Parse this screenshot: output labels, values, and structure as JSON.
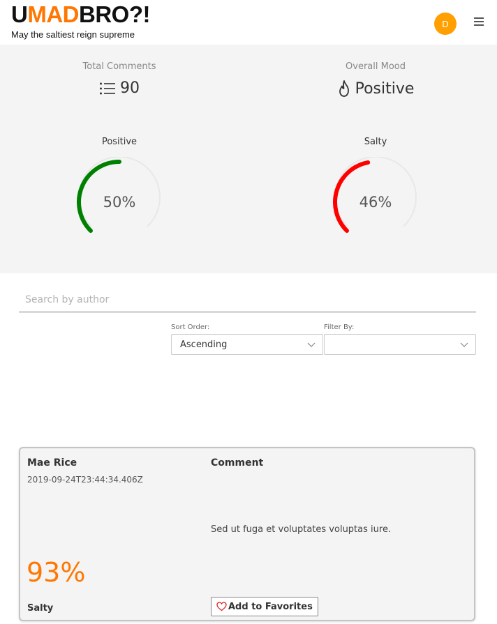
{
  "header": {
    "logo_u": "U",
    "logo_mad": "MAD",
    "logo_rest": "BRO?!",
    "tagline": "May the saltiest reign supreme",
    "avatar_initial": "D",
    "menu_icon": "hamburger-menu-icon"
  },
  "stats": {
    "total_comments_label": "Total Comments",
    "total_comments_value": "90",
    "total_comments_icon": "list-icon",
    "overall_mood_label": "Overall Mood",
    "overall_mood_value": "Positive",
    "overall_mood_icon": "flame-icon",
    "positive_gauge": {
      "label": "Positive",
      "text": "50%",
      "percent": 50,
      "color": "#008000"
    },
    "salty_gauge": {
      "label": "Salty",
      "text": "46%",
      "percent": 46,
      "color": "#ff0000"
    }
  },
  "search": {
    "placeholder": "Search by author",
    "value": ""
  },
  "filters": {
    "sort_label": "Sort Order:",
    "sort_value": "Ascending",
    "filter_label": "Filter By:",
    "filter_value": ""
  },
  "comments": [
    {
      "author": "Mae Rice",
      "timestamp": "2019-09-24T23:44:34.406Z",
      "score": "93%",
      "mood": "Salty",
      "comment_heading": "Comment",
      "comment_text": "Sed ut fuga et voluptates voluptas iure.",
      "favorite_label": "Add to Favorites"
    }
  ],
  "colors": {
    "accent": "#ff7700",
    "avatar": "#ff9f00",
    "panel": "#f4f4f4"
  }
}
